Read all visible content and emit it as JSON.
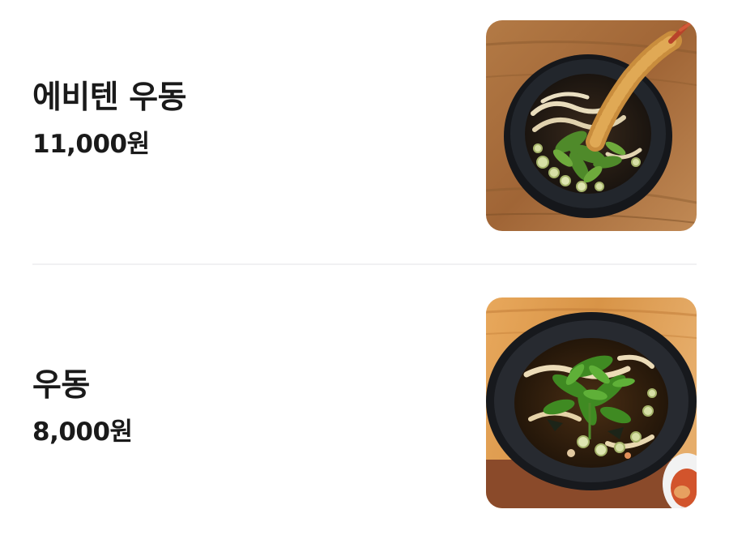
{
  "menu": {
    "items": [
      {
        "name": "에비텐 우동",
        "price": "11,000원",
        "image_icon": "ebiten-udon-photo"
      },
      {
        "name": "우동",
        "price": "8,000원",
        "image_icon": "udon-photo"
      }
    ]
  }
}
